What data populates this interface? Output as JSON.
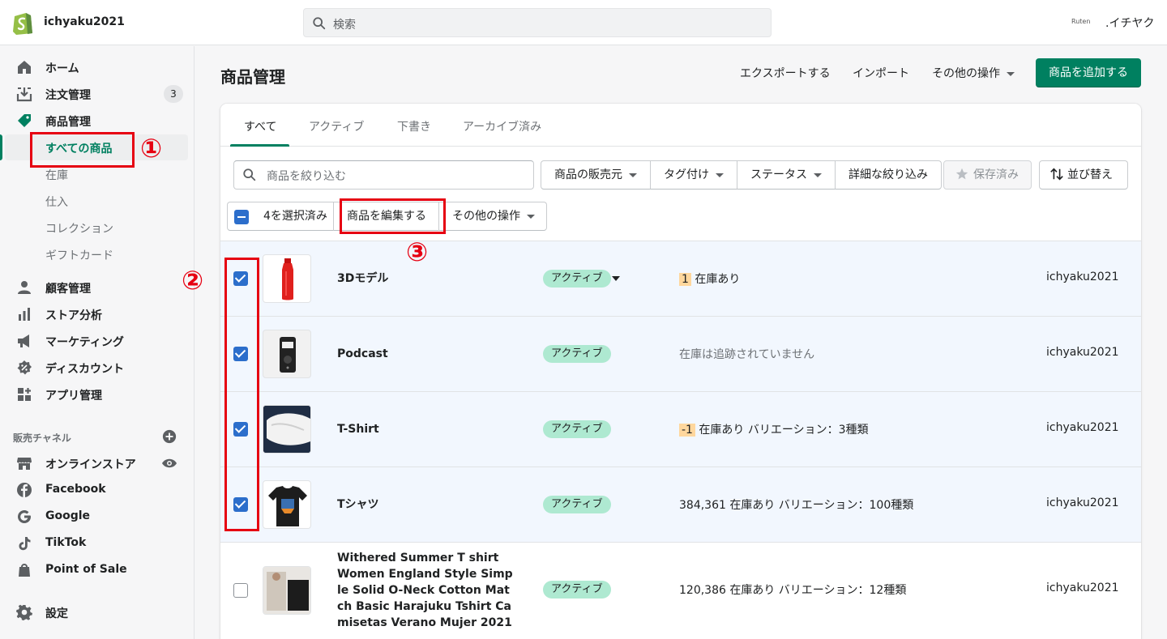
{
  "topbar": {
    "store_name": "ichyaku2021",
    "search_placeholder": "検索",
    "partner_logo": "Ruten",
    "user_name": ".イチヤク"
  },
  "sidebar": {
    "home": "ホーム",
    "orders": "注文管理",
    "orders_badge": "3",
    "products": "商品管理",
    "sub_all_products": "すべての商品",
    "sub_inventory": "在庫",
    "sub_transfers": "仕入",
    "sub_collections": "コレクション",
    "sub_gift_cards": "ギフトカード",
    "customers": "顧客管理",
    "analytics": "ストア分析",
    "marketing": "マーケティング",
    "discounts": "ディスカウント",
    "apps": "アプリ管理",
    "sales_channels_title": "販売チャネル",
    "online_store": "オンラインストア",
    "facebook": "Facebook",
    "google": "Google",
    "tiktok": "TikTok",
    "pos": "Point of Sale",
    "settings": "設定"
  },
  "annotations": {
    "one": "①",
    "two": "②",
    "three": "③"
  },
  "header": {
    "title": "商品管理",
    "export": "エクスポートする",
    "import": "インポート",
    "more_actions": "その他の操作",
    "add_product": "商品を追加する"
  },
  "tabs": [
    "すべて",
    "アクティブ",
    "下書き",
    "アーカイブ済み"
  ],
  "filters": {
    "search_placeholder": "商品を絞り込む",
    "vendor": "商品の販売元",
    "tagged": "タグ付け",
    "status": "ステータス",
    "more_filters": "詳細な絞り込み",
    "saved": "保存済み",
    "sort": "並び替え"
  },
  "bulk": {
    "selected": "4を選択済み",
    "edit_products": "商品を編集する",
    "more_actions": "その他の操作"
  },
  "products": [
    {
      "name": "3Dモデル",
      "status": "アクティブ",
      "inv_num": "1",
      "inv_text": " 在庫あり",
      "vendor": "ichyaku2021"
    },
    {
      "name": "Podcast",
      "status": "アクティブ",
      "inv_text": "在庫は追跡されていません",
      "vendor": "ichyaku2021"
    },
    {
      "name": "T-Shirt",
      "status": "アクティブ",
      "inv_num": "-1",
      "inv_text": " 在庫あり バリエーション：3種類",
      "vendor": "ichyaku2021"
    },
    {
      "name": "Tシャツ",
      "status": "アクティブ",
      "inv_text": "384,361 在庫あり バリエーション：100種類",
      "vendor": "ichyaku2021"
    },
    {
      "name_lines": [
        "Withered Summer T shirt",
        "Women England Style Simp",
        "le Solid O-Neck Cotton Mat",
        "ch Basic Harajuku Tshirt Ca",
        "misetas Verano Mujer 2021"
      ],
      "status": "アクティブ",
      "inv_text": "120,386 在庫あり バリエーション：12種類",
      "vendor": "ichyaku2021"
    }
  ],
  "colors": {
    "primary": "#008060",
    "status_active": "#aee9d1",
    "annotation": "#e60012",
    "selected_row": "#f2f7fe",
    "checkbox": "#2c6ecb"
  }
}
